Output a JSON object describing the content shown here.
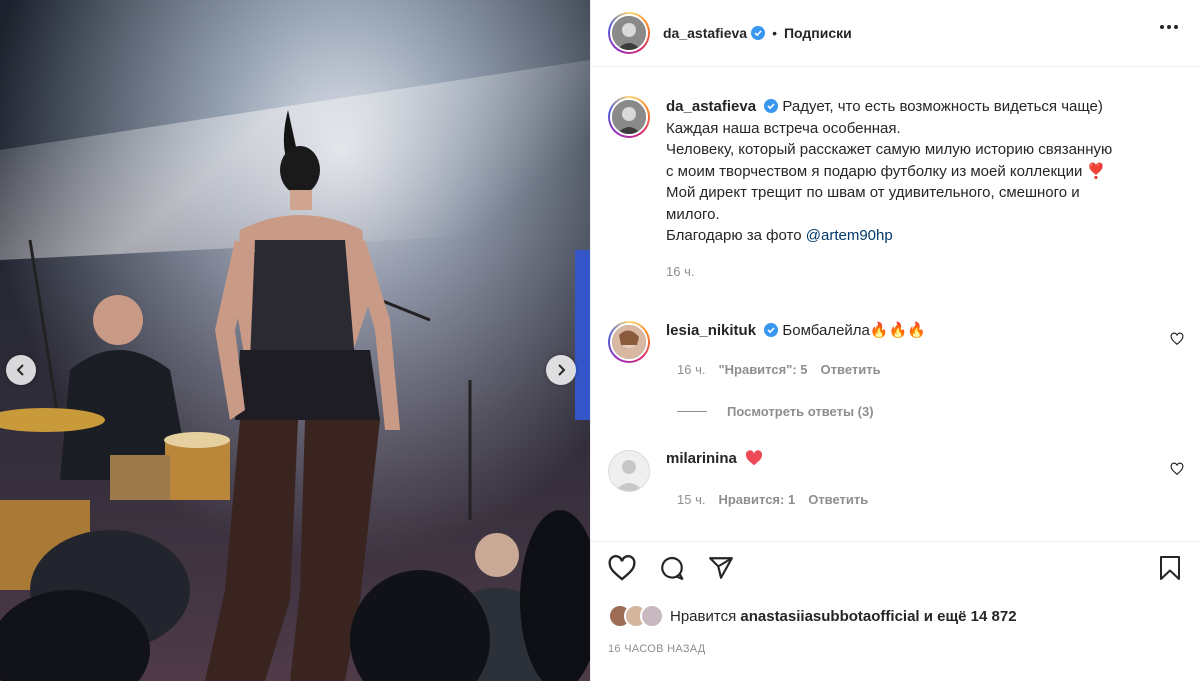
{
  "post": {
    "username": "da_astafieva",
    "separator": "•",
    "follow_status": "Подписки"
  },
  "caption": {
    "username": "da_astafieva",
    "lines": [
      "Радует, что есть возможность видеться чаще)",
      "Каждая наша встреча особенная.",
      "Человеку, который расскажет самую милую историю связанную",
      "с моим творчеством я подарю футболку из моей коллекции ❣️",
      "Мой директ трещит по швам от удивительного, смешного и",
      "милого.",
      "Благодарю за фото"
    ],
    "mention": "@artem90hp",
    "time": "16 ч."
  },
  "comments": [
    {
      "username": "lesia_nikituk",
      "verified": true,
      "text": "Бомбалейла🔥🔥🔥",
      "time": "16 ч.",
      "likes": "\"Нравится\": 5",
      "reply": "Ответить"
    },
    {
      "username": "milarinina",
      "verified": false,
      "text": "",
      "time": "15 ч.",
      "likes": "Нравится: 1",
      "reply": "Ответить"
    }
  ],
  "view_replies": "Посмотреть ответы (3)",
  "likes": {
    "prefix": "Нравится",
    "user": "anastasiiasubbotaofficial",
    "suffix": "и ещё 14 872"
  },
  "post_age": "16 ЧАСОВ НАЗАД",
  "colors": {
    "verified": "#3897f0",
    "heart_red": "#ed4956",
    "link": "#00376b",
    "secondary_text": "#8e8e8e"
  },
  "icons": [
    "heart-icon",
    "comment-icon",
    "share-icon",
    "bookmark-icon",
    "more-icon",
    "chevron-left-icon",
    "chevron-right-icon"
  ]
}
